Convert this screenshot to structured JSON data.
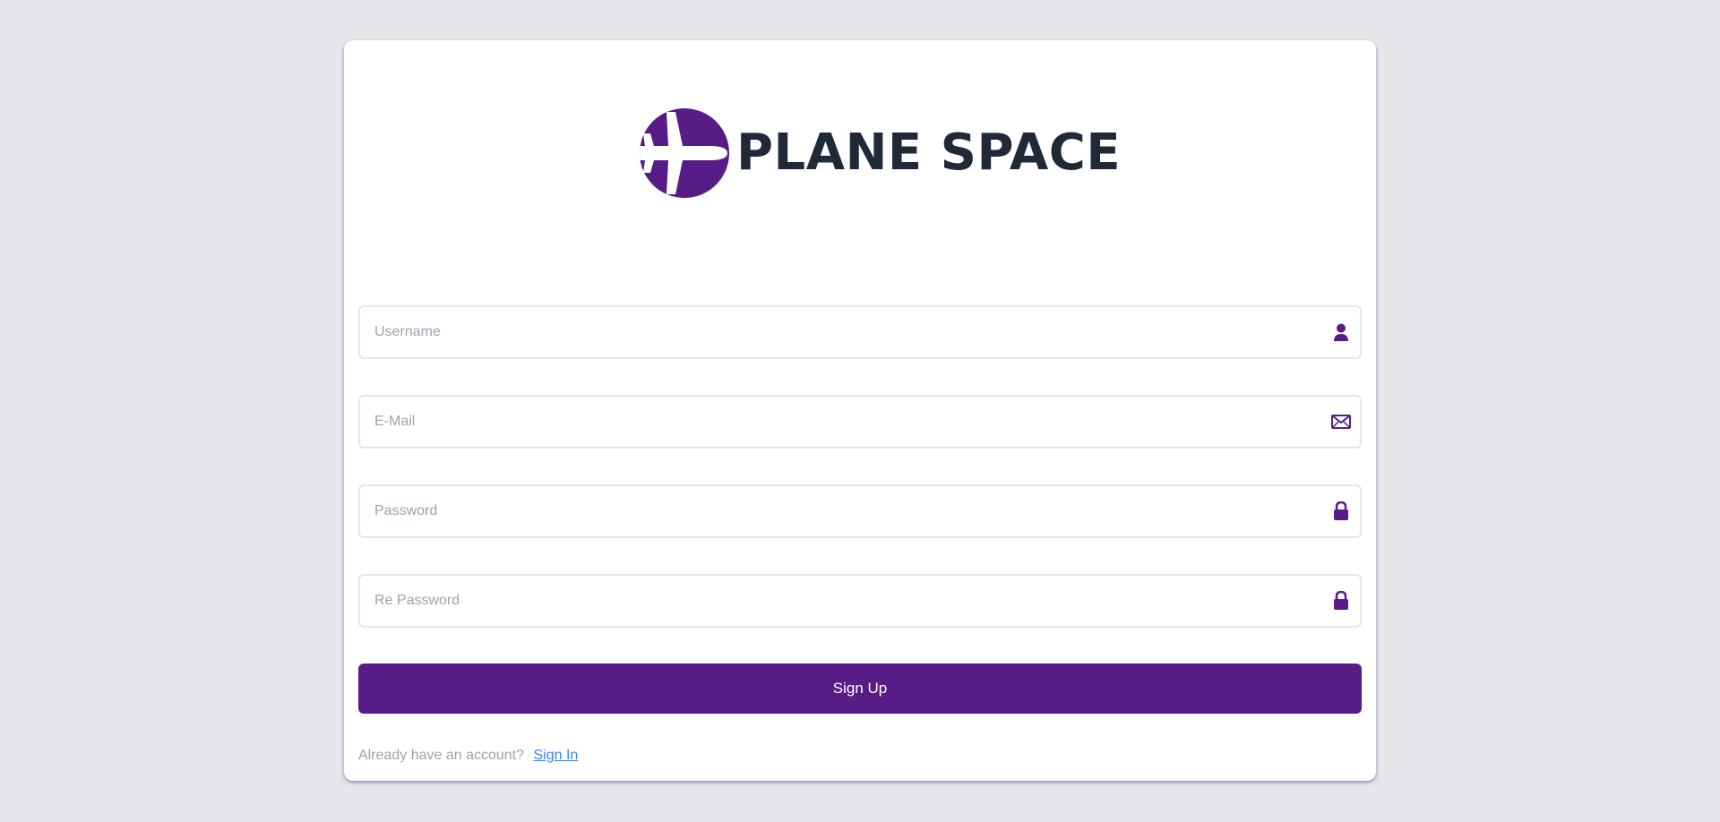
{
  "brand": {
    "name": "PLANE SPACE",
    "accent_color": "#581c87",
    "logo_icon": "airplane-icon"
  },
  "form": {
    "username": {
      "placeholder": "Username",
      "value": "",
      "icon": "user-icon"
    },
    "email": {
      "placeholder": "E-Mail",
      "value": "",
      "icon": "envelope-icon"
    },
    "password": {
      "placeholder": "Password",
      "value": "",
      "icon": "lock-icon"
    },
    "repassword": {
      "placeholder": "Re Password",
      "value": "",
      "icon": "lock-icon"
    },
    "submit_label": "Sign Up"
  },
  "footer": {
    "prompt": "Already have an account?",
    "link_label": "Sign In",
    "link_color": "#3b82f6"
  }
}
